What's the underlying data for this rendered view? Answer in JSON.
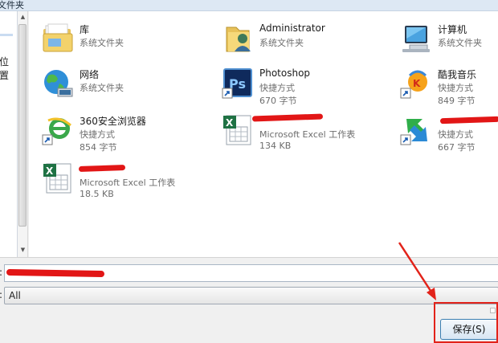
{
  "window": {
    "title_fragment": "文件夹"
  },
  "navigation": {
    "visible_label": "位置"
  },
  "files": [
    {
      "name": "库",
      "type": "系统文件夹",
      "size": "",
      "icon": "library-icon"
    },
    {
      "name": "Administrator",
      "type": "系统文件夹",
      "size": "",
      "icon": "user-folder-icon"
    },
    {
      "name": "计算机",
      "type": "系统文件夹",
      "size": "",
      "icon": "computer-icon"
    },
    {
      "name": "网络",
      "type": "系统文件夹",
      "size": "",
      "icon": "network-globe-icon"
    },
    {
      "name": "Photoshop",
      "type": "快捷方式",
      "size": "670 字节",
      "icon": "photoshop-shortcut-icon"
    },
    {
      "name": "酷我音乐",
      "type": "快捷方式",
      "size": "849 字节",
      "icon": "kuwo-music-shortcut-icon"
    },
    {
      "name": "360安全浏览器",
      "type": "快捷方式",
      "size": "854 字节",
      "icon": "ie-browser-shortcut-icon"
    },
    {
      "name": "",
      "type": "Microsoft Excel 工作表",
      "size": "134 KB",
      "icon": "excel-file-icon"
    },
    {
      "name": "",
      "type": "快捷方式",
      "size": "667 字节",
      "icon": "green-blue-arrows-shortcut-icon"
    },
    {
      "name": "",
      "type": "Microsoft Excel 工作表",
      "size": "18.5 KB",
      "icon": "excel-file-icon"
    }
  ],
  "form": {
    "colon": ":",
    "file_name_value": "",
    "file_type_value": "All"
  },
  "buttons": {
    "save_label": "保存(S)"
  },
  "colors": {
    "annotation": "#e2231a",
    "redaction": "#e21616",
    "button_border": "#3c7fb1"
  }
}
